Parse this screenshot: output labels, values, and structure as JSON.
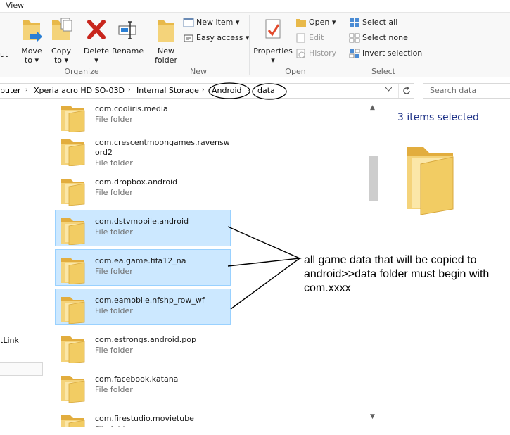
{
  "menubar": {
    "view_tab": "View"
  },
  "ribbon": {
    "organize": {
      "label": "Organize",
      "move_to": [
        "Move",
        "to"
      ],
      "copy_to": [
        "Copy",
        "to"
      ],
      "delete": "Delete",
      "rename": "Rename",
      "cut_fragment": "ut"
    },
    "new": {
      "label": "New",
      "new_folder": [
        "New",
        "folder"
      ],
      "new_item": "New item",
      "easy_access": "Easy access"
    },
    "open": {
      "label": "Open",
      "properties": "Properties",
      "open": "Open",
      "edit": "Edit",
      "history": "History"
    },
    "select": {
      "label": "Select",
      "select_all": "Select all",
      "select_none": "Select none",
      "invert_selection": "Invert selection"
    }
  },
  "address": {
    "crumbs": [
      "puter",
      "Xperia acro HD SO-03D",
      "Internal Storage",
      "Android",
      "data"
    ]
  },
  "search": {
    "placeholder": "Search data"
  },
  "nav": {
    "link_fragment": "tLink"
  },
  "files": [
    {
      "name": "com.cooliris.media",
      "type": "File folder",
      "selected": false
    },
    {
      "name": "com.crescentmoongames.ravensword2",
      "name_lines": "com.crescentmoongames.ravensw\nord2",
      "type": "File folder",
      "selected": false
    },
    {
      "name": "com.dropbox.android",
      "type": "File folder",
      "selected": false
    },
    {
      "name": "com.dstvmobile.android",
      "type": "File folder",
      "selected": true
    },
    {
      "name": "com.ea.game.fifa12_na",
      "type": "File folder",
      "selected": true
    },
    {
      "name": "com.eamobile.nfshp_row_wf",
      "type": "File folder",
      "selected": true
    },
    {
      "name": "com.estrongs.android.pop",
      "type": "File folder",
      "selected": false
    },
    {
      "name": "com.facebook.katana",
      "type": "File folder",
      "selected": false
    },
    {
      "name": "com.firestudio.movietube",
      "type": "File folder",
      "selected": false
    }
  ],
  "details": {
    "selection_count": "3 items selected"
  },
  "annotation": {
    "text": "all game data that will be copied to android>>data folder must begin with com.xxxx"
  },
  "colors": {
    "selection_fill": "#cce8ff",
    "selection_border": "#99d1ff",
    "details_text": "#1e3287",
    "folder_yellow": "#f4d37a"
  },
  "icons": [
    "move-to-icon",
    "copy-to-icon",
    "delete-icon",
    "rename-icon",
    "new-folder-icon",
    "new-item-icon",
    "easy-access-icon",
    "properties-icon",
    "open-icon",
    "edit-icon",
    "history-icon",
    "select-all-icon",
    "select-none-icon",
    "invert-selection-icon",
    "folder-icon",
    "refresh-icon"
  ]
}
